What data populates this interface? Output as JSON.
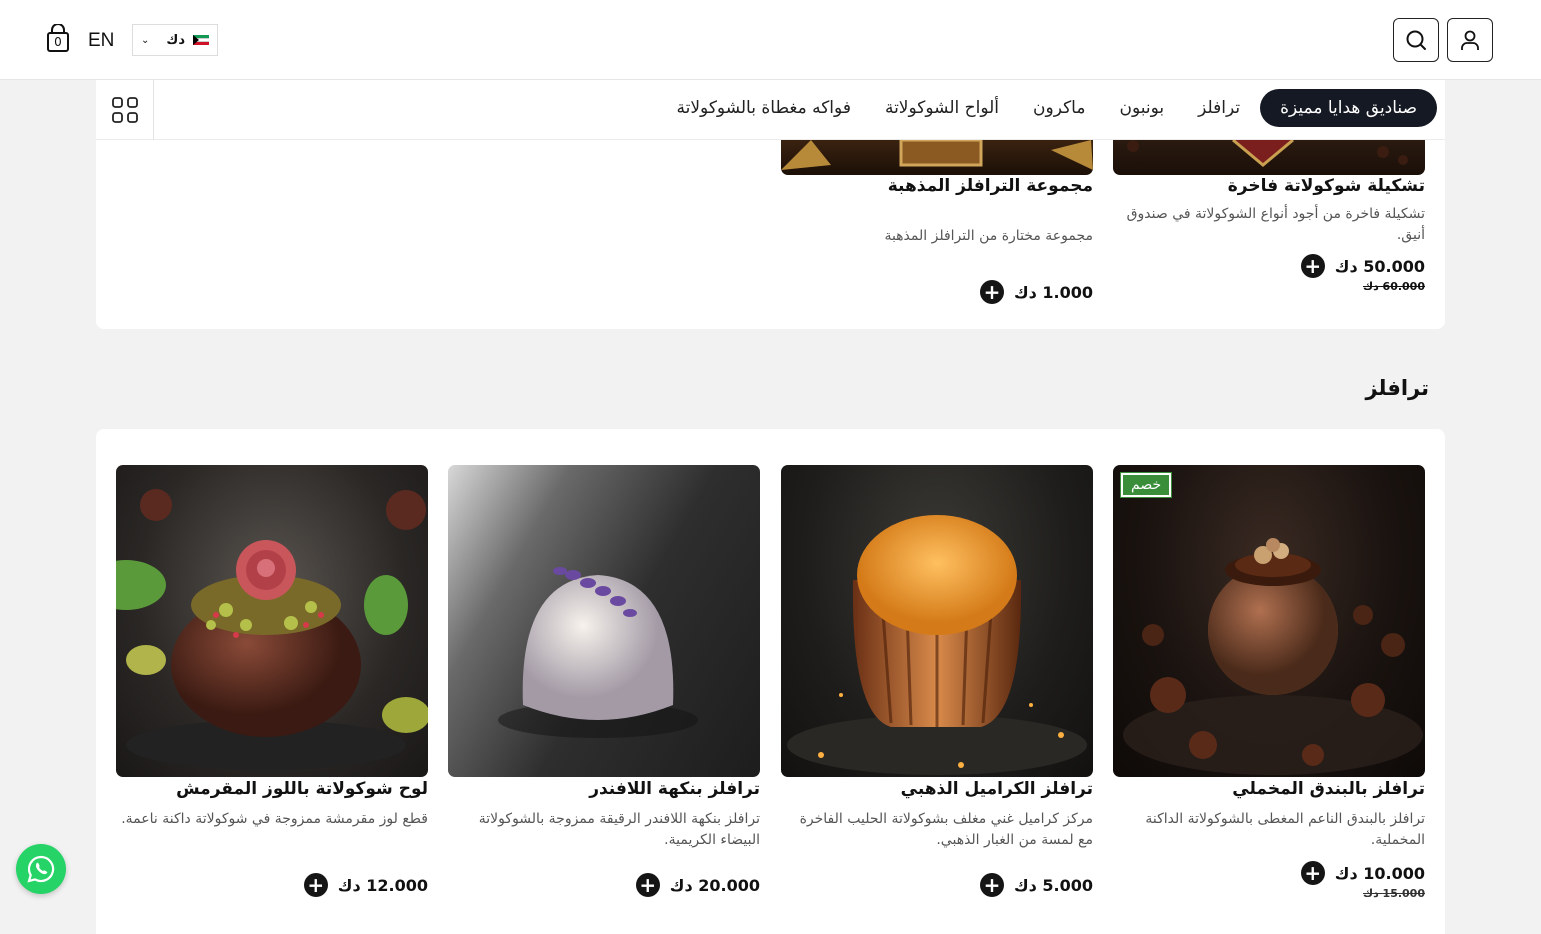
{
  "header": {
    "cart_count": "0",
    "lang": "EN",
    "currency": "دك",
    "icons": [
      "cart-icon",
      "search-icon",
      "user-icon",
      "grid-icon",
      "whatsapp-icon"
    ]
  },
  "categories": [
    {
      "label": "صناديق هدايا مميزة",
      "active": true
    },
    {
      "label": "ترافلز"
    },
    {
      "label": "بونبون"
    },
    {
      "label": "ماكرون"
    },
    {
      "label": "ألواح الشوكولاتة"
    },
    {
      "label": "فواكه مغطاة بالشوكولاتة"
    }
  ],
  "featured": [
    {
      "name": "تشكيلة شوكولاتة فاخرة",
      "desc": "تشكيلة فاخرة من أجود أنواع الشوكولاتة في صندوق أنيق.",
      "price": "50.000 دك",
      "old_price": "60.000 دك"
    },
    {
      "name": "مجموعة الترافلز المذهبة",
      "desc": "مجموعة مختارة من الترافلز المذهبة",
      "price": "1.000 دك"
    }
  ],
  "truffles": {
    "title": "ترافلز",
    "badge": "خصم",
    "products": [
      {
        "name": "ترافلز بالبندق المخملي",
        "desc": "ترافلز بالبندق الناعم المغطى بالشوكولاتة الداكنة المخملية.",
        "price": "10.000 دك",
        "old_price": "15.000 دك"
      },
      {
        "name": "ترافلز الكراميل الذهبي",
        "desc": "مركز كراميل غني مغلف بشوكولاتة الحليب الفاخرة مع لمسة من الغبار الذهبي.",
        "price": "5.000 دك"
      },
      {
        "name": "ترافلز بنكهة اللافندر",
        "desc": "ترافلز بنكهة اللافندر الرقيقة ممزوجة بالشوكولاتة البيضاء الكريمية.",
        "price": "20.000 دك"
      },
      {
        "name": "لوح شوكولاتة باللوز المقرمش",
        "desc": "قطع لوز مقرمشة ممزوجة في شوكولاتة داكنة ناعمة.",
        "price": "12.000 دك"
      }
    ]
  }
}
